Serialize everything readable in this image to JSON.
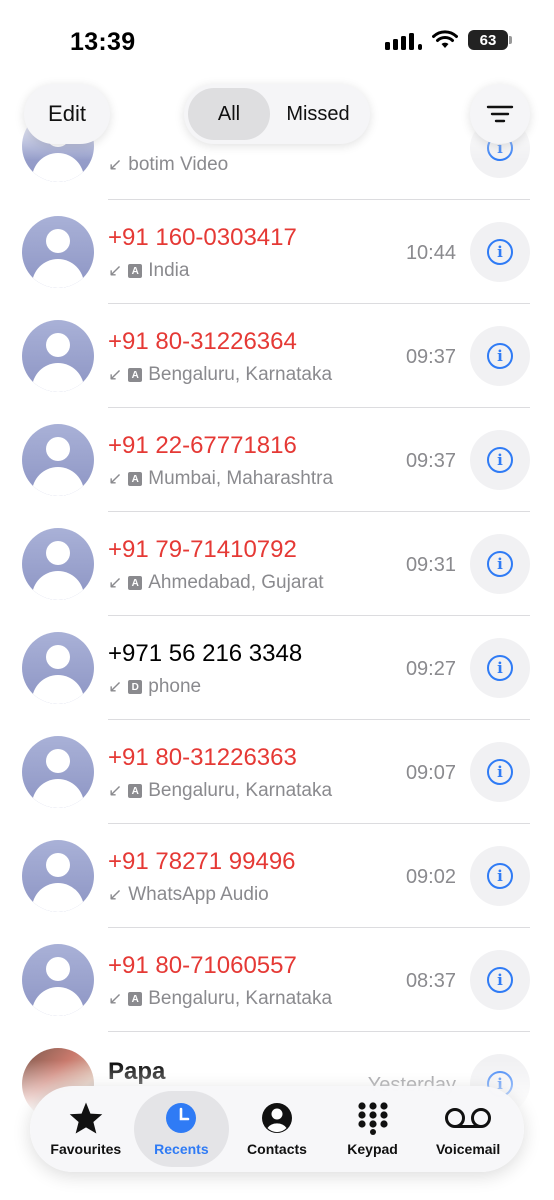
{
  "status": {
    "time": "13:39",
    "battery": "63"
  },
  "header": {
    "edit_label": "Edit",
    "segments": [
      "All",
      "Missed"
    ]
  },
  "calls": [
    {
      "name": "",
      "subtitle": "botim Video",
      "time": "",
      "missed": false,
      "tag": ""
    },
    {
      "name": "+91 160-0303417",
      "subtitle": "India",
      "time": "10:44",
      "missed": true,
      "tag": "A"
    },
    {
      "name": "+91 80-31226364",
      "subtitle": "Bengaluru, Karnataka",
      "time": "09:37",
      "missed": true,
      "tag": "A"
    },
    {
      "name": "+91 22-67771816",
      "subtitle": "Mumbai, Maharashtra",
      "time": "09:37",
      "missed": true,
      "tag": "A"
    },
    {
      "name": "+91 79-71410792",
      "subtitle": "Ahmedabad, Gujarat",
      "time": "09:31",
      "missed": true,
      "tag": "A"
    },
    {
      "name": "+971 56 216 3348",
      "subtitle": "phone",
      "time": "09:27",
      "missed": false,
      "tag": "D"
    },
    {
      "name": "+91 80-31226363",
      "subtitle": "Bengaluru, Karnataka",
      "time": "09:07",
      "missed": true,
      "tag": "A"
    },
    {
      "name": "+91 78271 99496",
      "subtitle": "WhatsApp Audio",
      "time": "09:02",
      "missed": true,
      "tag": ""
    },
    {
      "name": "+91 80-71060557",
      "subtitle": "Bengaluru, Karnataka",
      "time": "08:37",
      "missed": true,
      "tag": "A"
    },
    {
      "name": "Papa",
      "subtitle": "",
      "time": "Yesterday",
      "missed": false,
      "tag": ""
    }
  ],
  "tabs": [
    {
      "label": "Favourites",
      "icon": "star-icon",
      "active": false
    },
    {
      "label": "Recents",
      "icon": "clock-icon",
      "active": true
    },
    {
      "label": "Contacts",
      "icon": "person-circle-icon",
      "active": false
    },
    {
      "label": "Keypad",
      "icon": "keypad-icon",
      "active": false
    },
    {
      "label": "Voicemail",
      "icon": "voicemail-icon",
      "active": false
    }
  ],
  "colors": {
    "missed": "#e53935",
    "accent": "#2f7bf5",
    "secondary": "#8a8a8e"
  }
}
